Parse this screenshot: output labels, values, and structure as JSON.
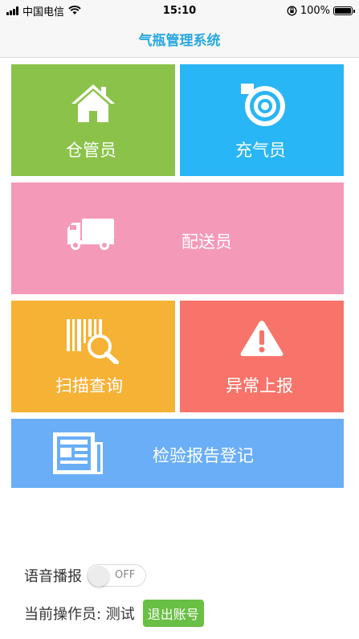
{
  "status_bar": {
    "carrier": "中国电信",
    "time": "15:10",
    "battery": "100%",
    "battery_level": 1.0
  },
  "nav": {
    "title": "气瓶管理系统"
  },
  "tiles": {
    "warehouse": {
      "label": "仓管员",
      "icon": "house-icon",
      "color": "#8bc34a"
    },
    "filler": {
      "label": "充气员",
      "icon": "gas-cylinder-valve-icon",
      "color": "#29b6f6"
    },
    "delivery": {
      "label": "配送员",
      "icon": "delivery-truck-icon",
      "color": "#f49ab8"
    },
    "scan": {
      "label": "扫描查询",
      "icon": "barcode-search-icon",
      "color": "#f6b234"
    },
    "report": {
      "label": "异常上报",
      "icon": "warning-icon",
      "color": "#f8746a"
    },
    "inspection": {
      "label": "检验报告登记",
      "icon": "report-document-icon",
      "color": "#6aaef7"
    }
  },
  "voice": {
    "label": "语音播报",
    "toggle_state": "OFF",
    "enabled": false
  },
  "operator": {
    "label": "当前操作员: 测试",
    "logout_label": "退出账号"
  }
}
